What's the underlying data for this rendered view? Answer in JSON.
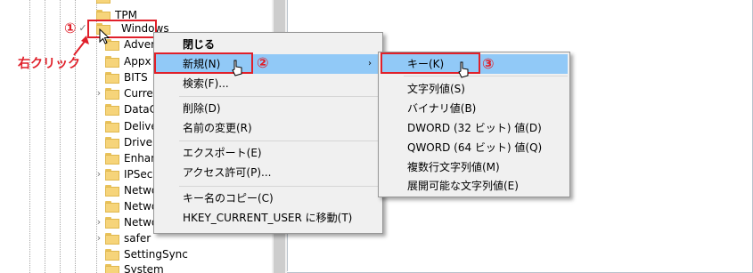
{
  "tree": {
    "items": [
      {
        "label": "TPM",
        "expander": ""
      },
      {
        "label": "Windows",
        "expander": "✓"
      },
      {
        "label": "Advert",
        "expander": ""
      },
      {
        "label": "Appx",
        "expander": ""
      },
      {
        "label": "BITS",
        "expander": ""
      },
      {
        "label": "Curren",
        "expander": "›"
      },
      {
        "label": "DataCo",
        "expander": ""
      },
      {
        "label": "Delive",
        "expander": ""
      },
      {
        "label": "Driver",
        "expander": ""
      },
      {
        "label": "Enhan",
        "expander": ""
      },
      {
        "label": "IPSec",
        "expander": "›"
      },
      {
        "label": "Netwo",
        "expander": ""
      },
      {
        "label": "Netwo",
        "expander": ""
      },
      {
        "label": "Netwo",
        "expander": "›"
      },
      {
        "label": "safer",
        "expander": "›"
      },
      {
        "label": "SettingSync",
        "expander": ""
      },
      {
        "label": "System",
        "expander": ""
      }
    ]
  },
  "annotations": {
    "step1": "①",
    "step2": "②",
    "step3": "③",
    "right_click": "右クリック"
  },
  "context_menu": {
    "collapse": "閉じる",
    "new": "新規(N)",
    "find": "検索(F)...",
    "delete": "削除(D)",
    "rename": "名前の変更(R)",
    "export": "エクスポート(E)",
    "permissions": "アクセス許可(P)...",
    "copy_key_name": "キー名のコピー(C)",
    "goto_hkcu": "HKEY_CURRENT_USER に移動(T)",
    "submenu_arrow": "›"
  },
  "new_submenu": {
    "key": "キー(K)",
    "string_value": "文字列値(S)",
    "binary_value": "バイナリ値(B)",
    "dword_value": "DWORD (32 ビット) 値(D)",
    "qword_value": "QWORD (64 ビット) 値(Q)",
    "multi_string_value": "複数行文字列値(M)",
    "expandable_string_value": "展開可能な文字列値(E)"
  },
  "colors": {
    "highlight": "#91c9f7",
    "annotation_red": "#e0202a",
    "menu_background": "#f0f0f0"
  }
}
